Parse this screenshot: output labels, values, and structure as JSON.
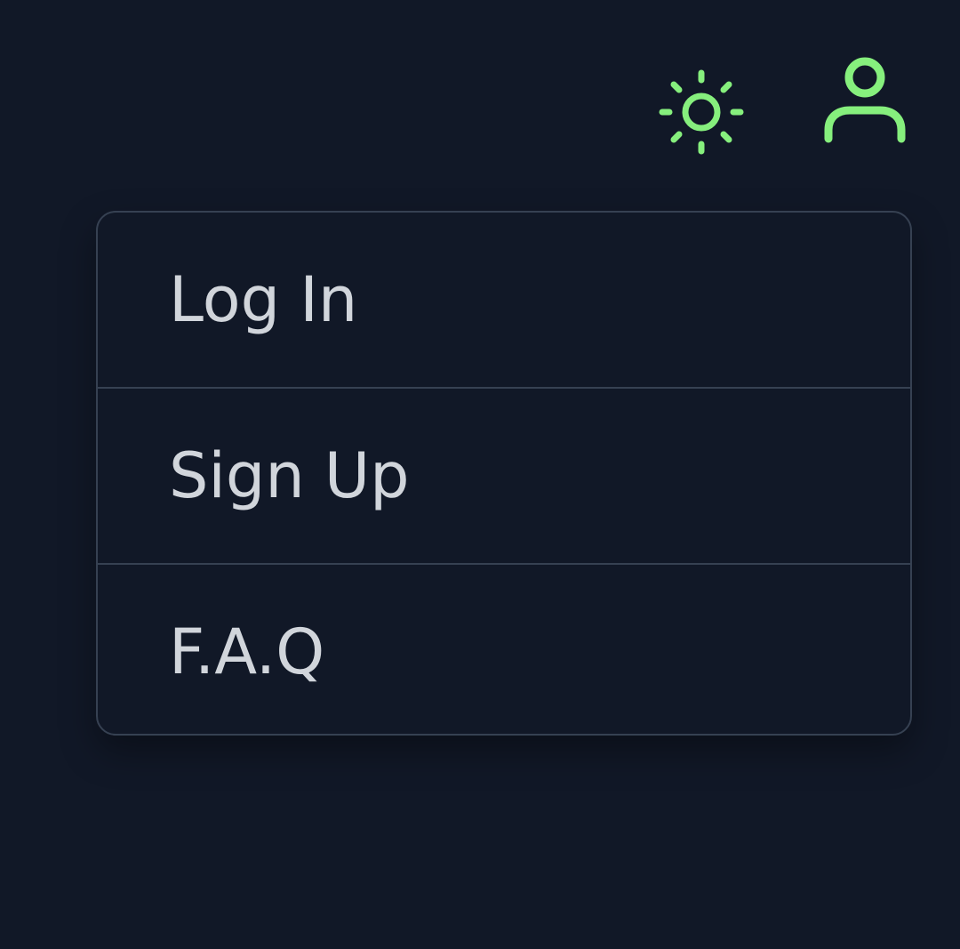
{
  "header": {
    "theme_toggle_icon": "sun-icon",
    "user_icon": "user-icon",
    "accent_color": "#86ef7d"
  },
  "menu": {
    "items": [
      {
        "label": "Log In"
      },
      {
        "label": "Sign Up"
      },
      {
        "label": "F.A.Q"
      }
    ]
  },
  "colors": {
    "background": "#111827",
    "border": "#364152",
    "text": "#d1d5db"
  }
}
